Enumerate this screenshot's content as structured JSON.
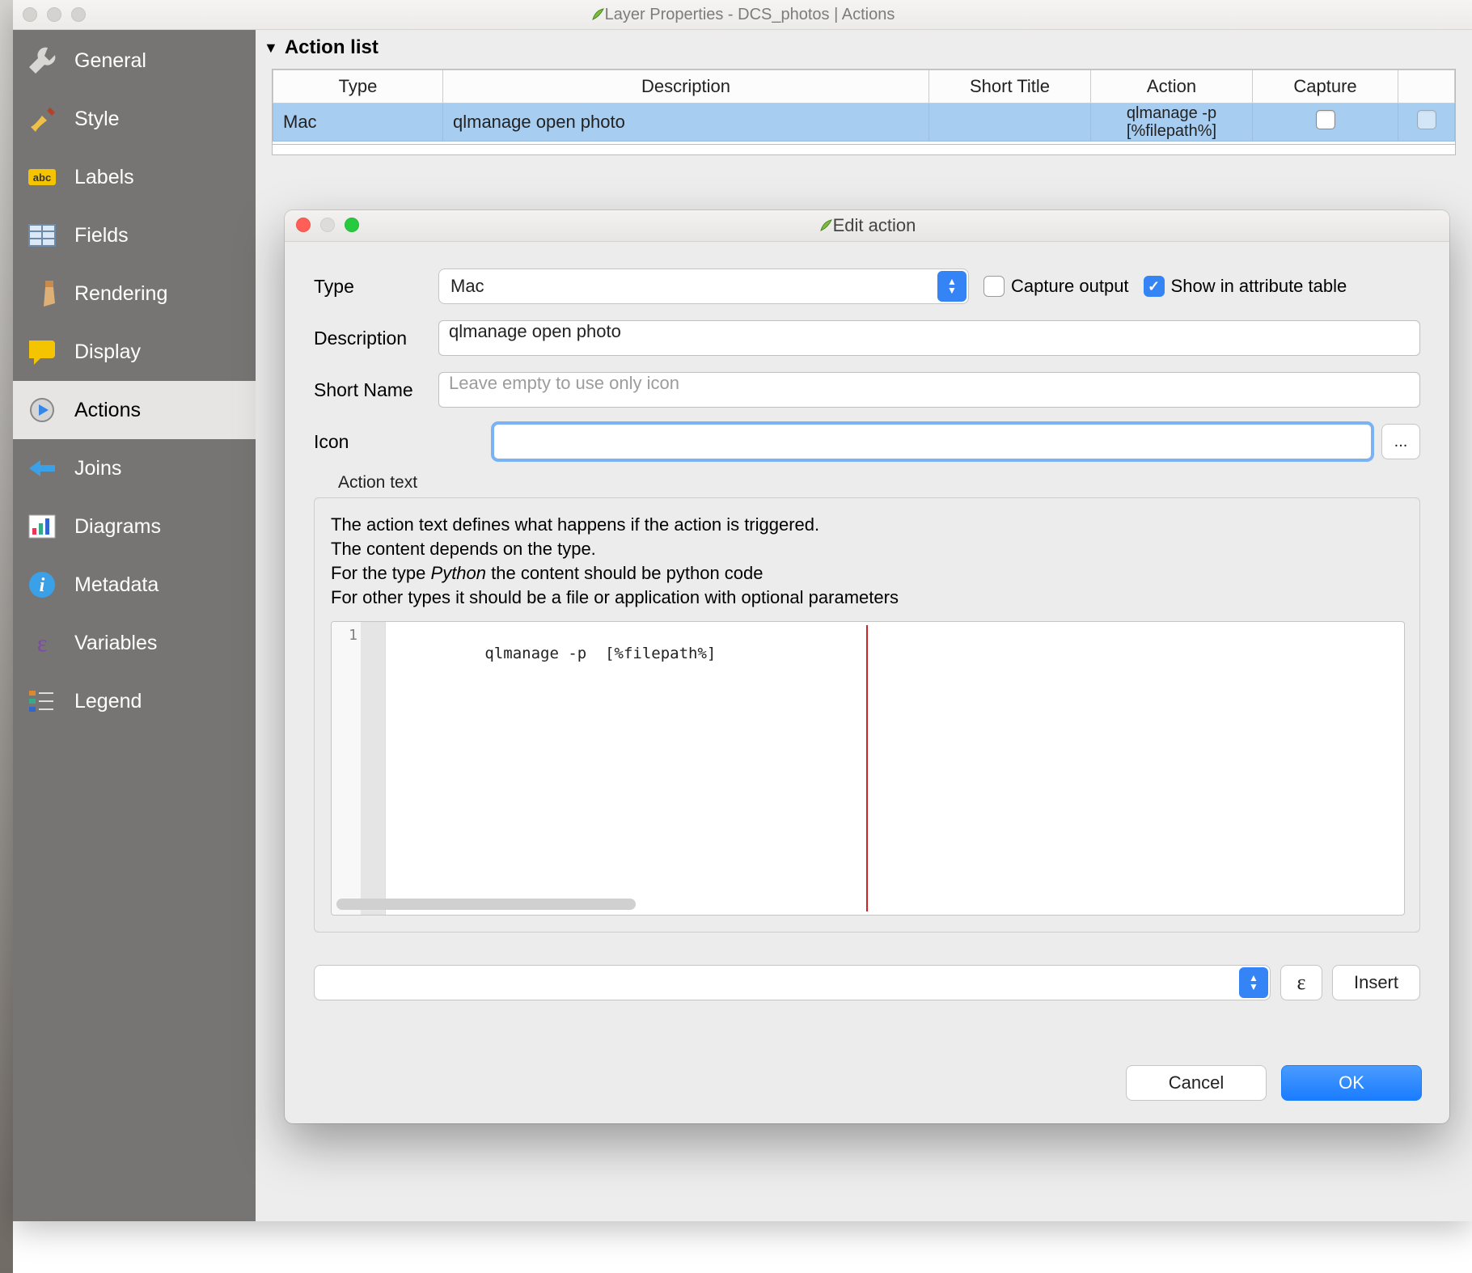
{
  "window": {
    "title": "Layer Properties - DCS_photos | Actions"
  },
  "sidebar": {
    "items": [
      {
        "label": "General"
      },
      {
        "label": "Style"
      },
      {
        "label": "Labels"
      },
      {
        "label": "Fields"
      },
      {
        "label": "Rendering"
      },
      {
        "label": "Display"
      },
      {
        "label": "Actions"
      },
      {
        "label": "Joins"
      },
      {
        "label": "Diagrams"
      },
      {
        "label": "Metadata"
      },
      {
        "label": "Variables"
      },
      {
        "label": "Legend"
      }
    ]
  },
  "section": {
    "title": "Action list"
  },
  "table": {
    "headers": {
      "type": "Type",
      "description": "Description",
      "short": "Short Title",
      "action": "Action",
      "capture": "Capture"
    },
    "row": {
      "type": "Mac",
      "description": "qlmanage open photo",
      "short": "",
      "action": "qlmanage -p [%filepath%]"
    }
  },
  "dialog": {
    "title": "Edit action",
    "labels": {
      "type": "Type",
      "description": "Description",
      "shortname": "Short Name",
      "icon": "Icon",
      "action_text": "Action text"
    },
    "type_value": "Mac",
    "capture_output": "Capture output",
    "show_in_attr": "Show in attribute table",
    "description_value": "qlmanage open photo",
    "shortname_placeholder": "Leave empty to use only icon",
    "icon_value": "",
    "browse": "...",
    "help": {
      "line1": "The action text defines what happens if the action is triggered.",
      "line2": "The content depends on the type.",
      "line3a": "For the type ",
      "line3b": "Python",
      "line3c": " the content should be python code",
      "line4": "For other types it should be a file or application with optional parameters"
    },
    "code": {
      "lineno": "1",
      "text": "qlmanage -p  [%filepath%]"
    },
    "epsilon": "ε",
    "insert": "Insert",
    "cancel": "Cancel",
    "ok": "OK"
  }
}
